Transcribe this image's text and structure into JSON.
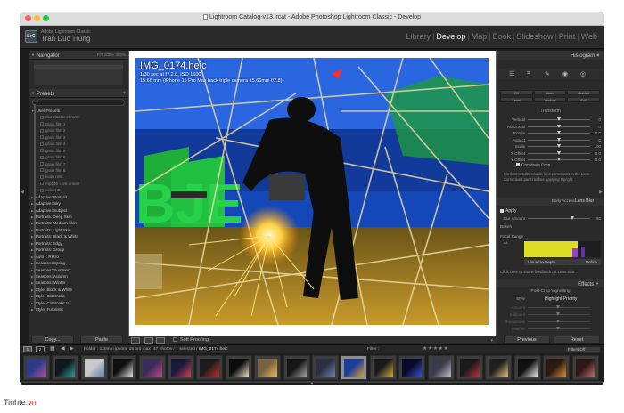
{
  "window": {
    "title": "Lightroom Catalog-v13.lrcat - Adobe Photoshop Lightroom Classic - Develop"
  },
  "identity": {
    "logo": "LrC",
    "app_line": "Adobe Lightroom Classic",
    "user": "Tran Duc Trung"
  },
  "modules": [
    "Library",
    "Develop",
    "Map",
    "Book",
    "Slideshow",
    "Print",
    "Web"
  ],
  "active_module": "Develop",
  "left_panel": {
    "navigator_title": "Navigator",
    "navigator_options": [
      "FIT",
      "100%",
      "400%"
    ],
    "presets_title": "Presets",
    "preset_items": [
      {
        "label": "User Presets",
        "kind": "group-open"
      },
      {
        "label": "dsc classic chrome",
        "kind": "sub"
      },
      {
        "label": "grain film 1",
        "kind": "sub"
      },
      {
        "label": "grain film 2",
        "kind": "sub"
      },
      {
        "label": "grain film 3",
        "kind": "sub"
      },
      {
        "label": "grain film 4",
        "kind": "sub"
      },
      {
        "label": "grain film 5",
        "kind": "sub"
      },
      {
        "label": "grain film 6",
        "kind": "sub"
      },
      {
        "label": "grain film 7",
        "kind": "sub"
      },
      {
        "label": "grain film 8",
        "kind": "sub"
      },
      {
        "label": "kodo m8",
        "kind": "sub"
      },
      {
        "label": "mp145 = 28 ansort",
        "kind": "sub"
      },
      {
        "label": "velvet 2",
        "kind": "sub"
      },
      {
        "label": "Adaptive: Portrait",
        "kind": "group"
      },
      {
        "label": "Adaptive: Sky",
        "kind": "group"
      },
      {
        "label": "Adaptive: Subject",
        "kind": "group"
      },
      {
        "label": "Portraits: Deep Skin",
        "kind": "group"
      },
      {
        "label": "Portraits: Medium Skin",
        "kind": "group"
      },
      {
        "label": "Portraits: Light Skin",
        "kind": "group"
      },
      {
        "label": "Portraits: Black & White",
        "kind": "group"
      },
      {
        "label": "Portraits: Edgy",
        "kind": "group"
      },
      {
        "label": "Portraits: Group",
        "kind": "group"
      },
      {
        "label": "Auto+: Retro",
        "kind": "group"
      },
      {
        "label": "Seasons: Spring",
        "kind": "group"
      },
      {
        "label": "Seasons: Summer",
        "kind": "group"
      },
      {
        "label": "Seasons: Autumn",
        "kind": "group"
      },
      {
        "label": "Seasons: Winter",
        "kind": "group"
      },
      {
        "label": "Style: Black & White",
        "kind": "group"
      },
      {
        "label": "Style: Cinematic",
        "kind": "group"
      },
      {
        "label": "Style: Cinematic II",
        "kind": "group"
      },
      {
        "label": "Style: Futuristic",
        "kind": "group"
      }
    ],
    "copy_label": "Copy...",
    "paste_label": "Paste"
  },
  "photo": {
    "filename": "IMG_0174.heic",
    "exposure_line": "1/30 sec at f / 2.8, ISO 1600",
    "lens_line": "15.66 mm (iPhone 15 Pro Max back triple camera 15.66mm f/2.8)"
  },
  "toolbar": {
    "soft_proofing": "Soft Proofing"
  },
  "right_panel": {
    "histogram_title": "Histogram",
    "upright_row1": [
      "Off",
      "Auto",
      "Guided"
    ],
    "upright_row2": [
      "Level",
      "Vertical",
      "Full"
    ],
    "transform_label": "Transform",
    "transform_sliders": [
      {
        "label": "Vertical",
        "value": "0",
        "pos": 0.5
      },
      {
        "label": "Horizontal",
        "value": "0",
        "pos": 0.5
      },
      {
        "label": "Rotate",
        "value": "0.0",
        "pos": 0.5
      },
      {
        "label": "Aspect",
        "value": "0",
        "pos": 0.5
      },
      {
        "label": "Scale",
        "value": "100",
        "pos": 0.5
      },
      {
        "label": "X Offset",
        "value": "0.0",
        "pos": 0.5
      },
      {
        "label": "Y Offset",
        "value": "0.0",
        "pos": 0.5
      }
    ],
    "constrain_crop": "Constrain Crop",
    "lens_note": "For best results, enable lens corrections in the Lens Corrections panel before applying Upright.",
    "lens_blur_access": "Early Access",
    "lens_blur_title": "Lens Blur",
    "apply_label": "Apply",
    "blur_amount_label": "Blur Amount",
    "blur_amount_value": "50",
    "bokeh_label": "Bokeh",
    "focal_range_label": "Focal Range",
    "focal_range_sub": "All",
    "visualize_depth": "Visualize Depth",
    "refine_label": "Refine",
    "feedback": "Click here to share feedback on Lens Blur",
    "effects_title": "Effects",
    "post_crop": "Post-Crop Vignetting",
    "style_label": "Style",
    "style_value": "Highlight Priority",
    "effects_sliders": [
      "Amount",
      "Midpoint",
      "Roundness",
      "Feather"
    ],
    "previous_label": "Previous",
    "reset_label": "Reset"
  },
  "filmstrip_bar": {
    "screen1": "1",
    "screen2": "2",
    "folder": "Folder : 120mm iphone 15 pro max",
    "count": "47 photos / 1 selected /",
    "selected_file": "IMG_0174.heic",
    "filter_label": "Filter :",
    "stars": "★★★★★",
    "filters_off": "Filters Off"
  },
  "filmstrip": {
    "selected_index": 11,
    "thumb_colors": [
      [
        "#2d3c8a",
        "#b24fa0"
      ],
      [
        "#101820",
        "#2aa6a0"
      ],
      [
        "#c9c9c9",
        "#5c7ea8"
      ],
      [
        "#111111",
        "#e8e8e8"
      ],
      [
        "#3c2a58",
        "#c44d8a"
      ],
      [
        "#1a1a3a",
        "#e03c5a"
      ],
      [
        "#1c1c1c",
        "#d02a2a"
      ],
      [
        "#0d0d0d",
        "#f0e6c8"
      ],
      [
        "#7a6240",
        "#e8c068"
      ],
      [
        "#161616",
        "#a8a8a8"
      ],
      [
        "#2a3040",
        "#6c88b8"
      ],
      [
        "#1e3c9a",
        "#e0a030"
      ],
      [
        "#1a1a1a",
        "#d8b040"
      ],
      [
        "#0a0a2a",
        "#3a58c8"
      ],
      [
        "#3a3a48",
        "#c8c0d0"
      ],
      [
        "#1a1a1a",
        "#c83040"
      ],
      [
        "#202020",
        "#e8c870"
      ],
      [
        "#101010",
        "#f0f0f0"
      ],
      [
        "#2a1a10",
        "#e09040"
      ],
      [
        "#301818",
        "#c87878"
      ]
    ]
  },
  "watermark": {
    "text": "Tinhte",
    "dot": ".vn"
  }
}
